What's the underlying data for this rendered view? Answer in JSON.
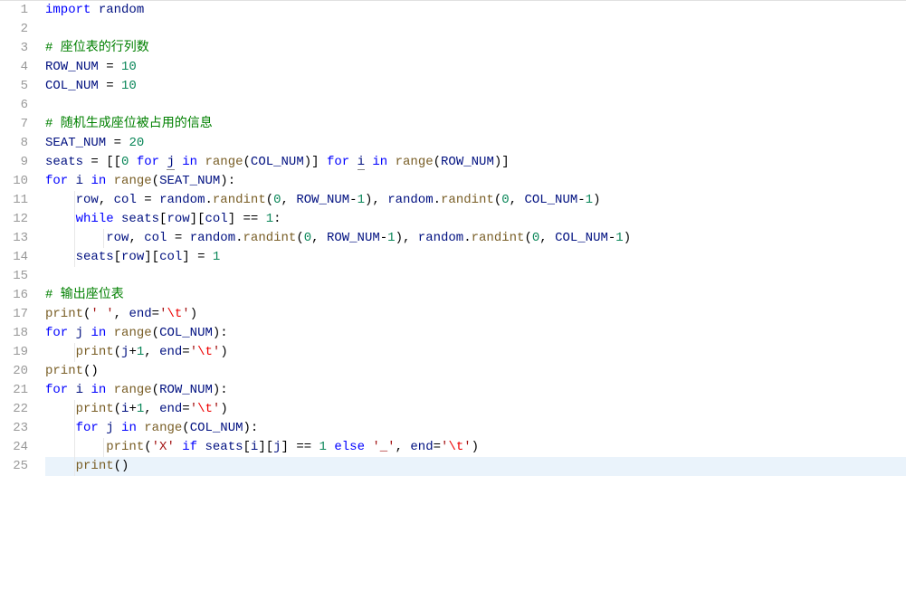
{
  "lineCount": 25,
  "highlightedLines": [
    25
  ],
  "lines": [
    [
      {
        "t": "import",
        "c": "kw"
      },
      {
        "t": " ",
        "c": "plain"
      },
      {
        "t": "random",
        "c": "var"
      }
    ],
    [],
    [
      {
        "t": "# 座位表的行列数",
        "c": "cm"
      }
    ],
    [
      {
        "t": "ROW_NUM",
        "c": "var"
      },
      {
        "t": " = ",
        "c": "op"
      },
      {
        "t": "10",
        "c": "num"
      }
    ],
    [
      {
        "t": "COL_NUM",
        "c": "var"
      },
      {
        "t": " = ",
        "c": "op"
      },
      {
        "t": "10",
        "c": "num"
      }
    ],
    [],
    [
      {
        "t": "# 随机生成座位被占用的信息",
        "c": "cm"
      }
    ],
    [
      {
        "t": "SEAT_NUM",
        "c": "var"
      },
      {
        "t": " = ",
        "c": "op"
      },
      {
        "t": "20",
        "c": "num"
      }
    ],
    [
      {
        "t": "seats",
        "c": "var"
      },
      {
        "t": " = [[",
        "c": "op"
      },
      {
        "t": "0",
        "c": "num"
      },
      {
        "t": " ",
        "c": "plain"
      },
      {
        "t": "for",
        "c": "kw"
      },
      {
        "t": " ",
        "c": "plain"
      },
      {
        "t": "j",
        "c": "var",
        "u": true
      },
      {
        "t": " ",
        "c": "plain"
      },
      {
        "t": "in",
        "c": "kw"
      },
      {
        "t": " ",
        "c": "plain"
      },
      {
        "t": "range",
        "c": "fn"
      },
      {
        "t": "(",
        "c": "op"
      },
      {
        "t": "COL_NUM",
        "c": "var"
      },
      {
        "t": ")] ",
        "c": "op"
      },
      {
        "t": "for",
        "c": "kw"
      },
      {
        "t": " ",
        "c": "plain"
      },
      {
        "t": "i",
        "c": "var",
        "u": true
      },
      {
        "t": " ",
        "c": "plain"
      },
      {
        "t": "in",
        "c": "kw"
      },
      {
        "t": " ",
        "c": "plain"
      },
      {
        "t": "range",
        "c": "fn"
      },
      {
        "t": "(",
        "c": "op"
      },
      {
        "t": "ROW_NUM",
        "c": "var"
      },
      {
        "t": ")]",
        "c": "op"
      }
    ],
    [
      {
        "t": "for",
        "c": "kw"
      },
      {
        "t": " ",
        "c": "plain"
      },
      {
        "t": "i",
        "c": "var"
      },
      {
        "t": " ",
        "c": "plain"
      },
      {
        "t": "in",
        "c": "kw"
      },
      {
        "t": " ",
        "c": "plain"
      },
      {
        "t": "range",
        "c": "fn"
      },
      {
        "t": "(",
        "c": "op"
      },
      {
        "t": "SEAT_NUM",
        "c": "var"
      },
      {
        "t": "):",
        "c": "op"
      }
    ],
    [
      {
        "t": "    ",
        "c": "plain"
      },
      {
        "t": "row",
        "c": "var"
      },
      {
        "t": ", ",
        "c": "op"
      },
      {
        "t": "col",
        "c": "var"
      },
      {
        "t": " = ",
        "c": "op"
      },
      {
        "t": "random",
        "c": "var"
      },
      {
        "t": ".",
        "c": "op"
      },
      {
        "t": "randint",
        "c": "fn"
      },
      {
        "t": "(",
        "c": "op"
      },
      {
        "t": "0",
        "c": "num"
      },
      {
        "t": ", ",
        "c": "op"
      },
      {
        "t": "ROW_NUM",
        "c": "var"
      },
      {
        "t": "-",
        "c": "op"
      },
      {
        "t": "1",
        "c": "num"
      },
      {
        "t": "), ",
        "c": "op"
      },
      {
        "t": "random",
        "c": "var"
      },
      {
        "t": ".",
        "c": "op"
      },
      {
        "t": "randint",
        "c": "fn"
      },
      {
        "t": "(",
        "c": "op"
      },
      {
        "t": "0",
        "c": "num"
      },
      {
        "t": ", ",
        "c": "op"
      },
      {
        "t": "COL_NUM",
        "c": "var"
      },
      {
        "t": "-",
        "c": "op"
      },
      {
        "t": "1",
        "c": "num"
      },
      {
        "t": ")",
        "c": "op"
      }
    ],
    [
      {
        "t": "    ",
        "c": "plain"
      },
      {
        "t": "while",
        "c": "kw"
      },
      {
        "t": " ",
        "c": "plain"
      },
      {
        "t": "seats",
        "c": "var"
      },
      {
        "t": "[",
        "c": "op"
      },
      {
        "t": "row",
        "c": "var"
      },
      {
        "t": "][",
        "c": "op"
      },
      {
        "t": "col",
        "c": "var"
      },
      {
        "t": "] == ",
        "c": "op"
      },
      {
        "t": "1",
        "c": "num"
      },
      {
        "t": ":",
        "c": "op"
      }
    ],
    [
      {
        "t": "        ",
        "c": "plain"
      },
      {
        "t": "row",
        "c": "var"
      },
      {
        "t": ", ",
        "c": "op"
      },
      {
        "t": "col",
        "c": "var"
      },
      {
        "t": " = ",
        "c": "op"
      },
      {
        "t": "random",
        "c": "var"
      },
      {
        "t": ".",
        "c": "op"
      },
      {
        "t": "randint",
        "c": "fn"
      },
      {
        "t": "(",
        "c": "op"
      },
      {
        "t": "0",
        "c": "num"
      },
      {
        "t": ", ",
        "c": "op"
      },
      {
        "t": "ROW_NUM",
        "c": "var"
      },
      {
        "t": "-",
        "c": "op"
      },
      {
        "t": "1",
        "c": "num"
      },
      {
        "t": "), ",
        "c": "op"
      },
      {
        "t": "random",
        "c": "var"
      },
      {
        "t": ".",
        "c": "op"
      },
      {
        "t": "randint",
        "c": "fn"
      },
      {
        "t": "(",
        "c": "op"
      },
      {
        "t": "0",
        "c": "num"
      },
      {
        "t": ", ",
        "c": "op"
      },
      {
        "t": "COL_NUM",
        "c": "var"
      },
      {
        "t": "-",
        "c": "op"
      },
      {
        "t": "1",
        "c": "num"
      },
      {
        "t": ")",
        "c": "op"
      }
    ],
    [
      {
        "t": "    ",
        "c": "plain"
      },
      {
        "t": "seats",
        "c": "var"
      },
      {
        "t": "[",
        "c": "op"
      },
      {
        "t": "row",
        "c": "var"
      },
      {
        "t": "][",
        "c": "op"
      },
      {
        "t": "col",
        "c": "var"
      },
      {
        "t": "] = ",
        "c": "op"
      },
      {
        "t": "1",
        "c": "num"
      }
    ],
    [],
    [
      {
        "t": "# 输出座位表",
        "c": "cm"
      }
    ],
    [
      {
        "t": "print",
        "c": "fn"
      },
      {
        "t": "(",
        "c": "op"
      },
      {
        "t": "' '",
        "c": "str"
      },
      {
        "t": ", ",
        "c": "op"
      },
      {
        "t": "end",
        "c": "var"
      },
      {
        "t": "=",
        "c": "op"
      },
      {
        "t": "'",
        "c": "str"
      },
      {
        "t": "\\t",
        "c": "strx"
      },
      {
        "t": "'",
        "c": "str"
      },
      {
        "t": ")",
        "c": "op"
      }
    ],
    [
      {
        "t": "for",
        "c": "kw"
      },
      {
        "t": " ",
        "c": "plain"
      },
      {
        "t": "j",
        "c": "var"
      },
      {
        "t": " ",
        "c": "plain"
      },
      {
        "t": "in",
        "c": "kw"
      },
      {
        "t": " ",
        "c": "plain"
      },
      {
        "t": "range",
        "c": "fn"
      },
      {
        "t": "(",
        "c": "op"
      },
      {
        "t": "COL_NUM",
        "c": "var"
      },
      {
        "t": "):",
        "c": "op"
      }
    ],
    [
      {
        "t": "    ",
        "c": "plain"
      },
      {
        "t": "print",
        "c": "fn"
      },
      {
        "t": "(",
        "c": "op"
      },
      {
        "t": "j",
        "c": "var"
      },
      {
        "t": "+",
        "c": "op"
      },
      {
        "t": "1",
        "c": "num"
      },
      {
        "t": ", ",
        "c": "op"
      },
      {
        "t": "end",
        "c": "var"
      },
      {
        "t": "=",
        "c": "op"
      },
      {
        "t": "'",
        "c": "str"
      },
      {
        "t": "\\t",
        "c": "strx"
      },
      {
        "t": "'",
        "c": "str"
      },
      {
        "t": ")",
        "c": "op"
      }
    ],
    [
      {
        "t": "print",
        "c": "fn"
      },
      {
        "t": "()",
        "c": "op"
      }
    ],
    [
      {
        "t": "for",
        "c": "kw"
      },
      {
        "t": " ",
        "c": "plain"
      },
      {
        "t": "i",
        "c": "var"
      },
      {
        "t": " ",
        "c": "plain"
      },
      {
        "t": "in",
        "c": "kw"
      },
      {
        "t": " ",
        "c": "plain"
      },
      {
        "t": "range",
        "c": "fn"
      },
      {
        "t": "(",
        "c": "op"
      },
      {
        "t": "ROW_NUM",
        "c": "var"
      },
      {
        "t": "):",
        "c": "op"
      }
    ],
    [
      {
        "t": "    ",
        "c": "plain"
      },
      {
        "t": "print",
        "c": "fn"
      },
      {
        "t": "(",
        "c": "op"
      },
      {
        "t": "i",
        "c": "var"
      },
      {
        "t": "+",
        "c": "op"
      },
      {
        "t": "1",
        "c": "num"
      },
      {
        "t": ", ",
        "c": "op"
      },
      {
        "t": "end",
        "c": "var"
      },
      {
        "t": "=",
        "c": "op"
      },
      {
        "t": "'",
        "c": "str"
      },
      {
        "t": "\\t",
        "c": "strx"
      },
      {
        "t": "'",
        "c": "str"
      },
      {
        "t": ")",
        "c": "op"
      }
    ],
    [
      {
        "t": "    ",
        "c": "plain"
      },
      {
        "t": "for",
        "c": "kw"
      },
      {
        "t": " ",
        "c": "plain"
      },
      {
        "t": "j",
        "c": "var"
      },
      {
        "t": " ",
        "c": "plain"
      },
      {
        "t": "in",
        "c": "kw"
      },
      {
        "t": " ",
        "c": "plain"
      },
      {
        "t": "range",
        "c": "fn"
      },
      {
        "t": "(",
        "c": "op"
      },
      {
        "t": "COL_NUM",
        "c": "var"
      },
      {
        "t": "):",
        "c": "op"
      }
    ],
    [
      {
        "t": "        ",
        "c": "plain"
      },
      {
        "t": "print",
        "c": "fn"
      },
      {
        "t": "(",
        "c": "op"
      },
      {
        "t": "'X'",
        "c": "str"
      },
      {
        "t": " ",
        "c": "plain"
      },
      {
        "t": "if",
        "c": "kw"
      },
      {
        "t": " ",
        "c": "plain"
      },
      {
        "t": "seats",
        "c": "var"
      },
      {
        "t": "[",
        "c": "op"
      },
      {
        "t": "i",
        "c": "var"
      },
      {
        "t": "][",
        "c": "op"
      },
      {
        "t": "j",
        "c": "var"
      },
      {
        "t": "] == ",
        "c": "op"
      },
      {
        "t": "1",
        "c": "num"
      },
      {
        "t": " ",
        "c": "plain"
      },
      {
        "t": "else",
        "c": "kw"
      },
      {
        "t": " ",
        "c": "plain"
      },
      {
        "t": "'_'",
        "c": "str"
      },
      {
        "t": ", ",
        "c": "op"
      },
      {
        "t": "end",
        "c": "var"
      },
      {
        "t": "=",
        "c": "op"
      },
      {
        "t": "'",
        "c": "str"
      },
      {
        "t": "\\t",
        "c": "strx"
      },
      {
        "t": "'",
        "c": "str"
      },
      {
        "t": ")",
        "c": "op"
      }
    ],
    [
      {
        "t": "    ",
        "c": "plain"
      },
      {
        "t": "print",
        "c": "fn"
      },
      {
        "t": "()",
        "c": "op"
      }
    ]
  ],
  "guides": {
    "11": [
      1
    ],
    "12": [
      1
    ],
    "13": [
      1,
      2
    ],
    "14": [
      1
    ],
    "19": [
      1
    ],
    "22": [
      1
    ],
    "23": [
      1
    ],
    "24": [
      1,
      2
    ],
    "25": [
      1
    ]
  }
}
